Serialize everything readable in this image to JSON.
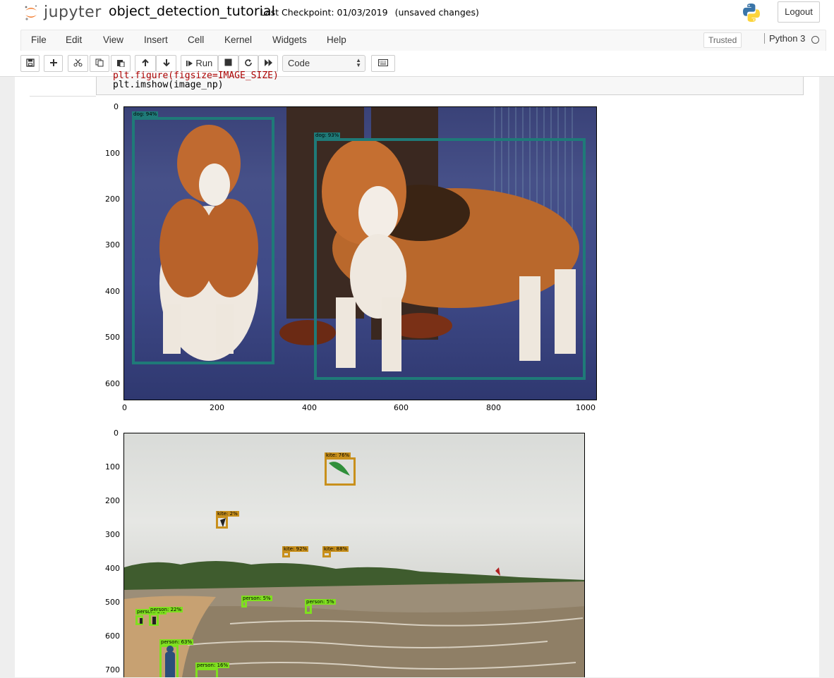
{
  "header": {
    "logo_text": "jupyter",
    "notebook_name": "object_detection_tutorial",
    "checkpoint": "Last Checkpoint: 01/03/2019",
    "unsaved": "(unsaved changes)",
    "logout_label": "Logout"
  },
  "menu": {
    "items": [
      "File",
      "Edit",
      "View",
      "Insert",
      "Cell",
      "Kernel",
      "Widgets",
      "Help"
    ],
    "trusted_label": "Trusted",
    "kernel_name": "Python 3"
  },
  "toolbar": {
    "run_label": "Run",
    "cell_type": "Code"
  },
  "code": {
    "line_partial": "plt.figure(figsize=IMAGE_SIZE)",
    "line_full": "plt.imshow(image_np)"
  },
  "plot1": {
    "y_ticks": [
      "0",
      "100",
      "200",
      "300",
      "400",
      "500",
      "600"
    ],
    "x_ticks": [
      "0",
      "200",
      "400",
      "600",
      "800",
      "1000"
    ],
    "box_color": "#1f7a78",
    "detections": [
      {
        "label": "dog: 94%"
      },
      {
        "label": "dog: 93%"
      }
    ]
  },
  "plot2": {
    "y_ticks": [
      "0",
      "100",
      "200",
      "300",
      "400",
      "500",
      "600",
      "700"
    ],
    "kite_color": "#c8901c",
    "person_color": "#7fe01f",
    "detections": [
      {
        "label": "kite: 76%"
      },
      {
        "label": "kite: 2%"
      },
      {
        "label": "kite: 92%"
      },
      {
        "label": "kite: 88%"
      },
      {
        "label": "person: 5%"
      },
      {
        "label": "person: 5%"
      },
      {
        "label": "person: 5%"
      },
      {
        "label": "person: 22%"
      },
      {
        "label": "person: 63%"
      },
      {
        "label": "person: 16%"
      }
    ]
  }
}
